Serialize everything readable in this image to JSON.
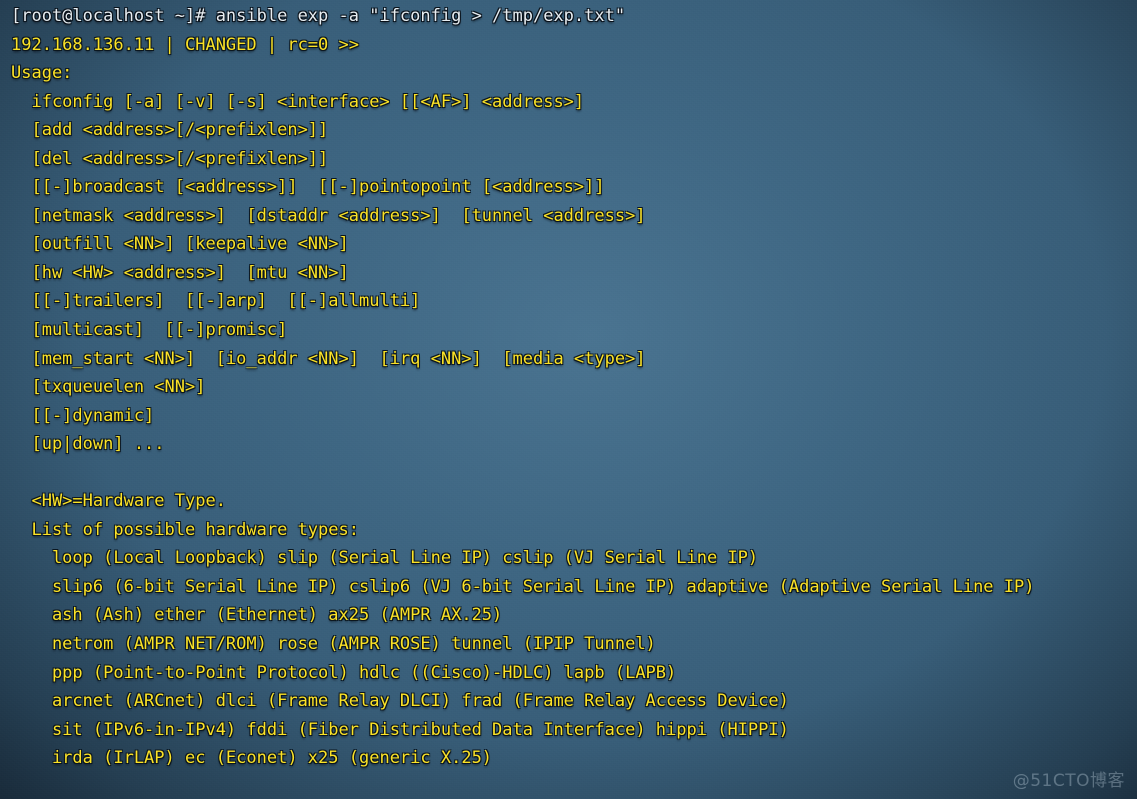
{
  "terminal": {
    "prompt_line": "[root@localhost ~]# ansible exp -a \"ifconfig > /tmp/exp.txt\"",
    "status_line": "192.168.136.11 | CHANGED | rc=0 >>",
    "lines": [
      {
        "text": "[root@localhost ~]# ansible exp -a \"ifconfig > /tmp/exp.txt\"",
        "style": "cmd"
      },
      {
        "text": "192.168.136.11 | CHANGED | rc=0 >>",
        "style": "out"
      },
      {
        "text": "Usage:",
        "style": "out"
      },
      {
        "text": "  ifconfig [-a] [-v] [-s] <interface> [[<AF>] <address>]",
        "style": "out"
      },
      {
        "text": "  [add <address>[/<prefixlen>]]",
        "style": "out"
      },
      {
        "text": "  [del <address>[/<prefixlen>]]",
        "style": "out"
      },
      {
        "text": "  [[-]broadcast [<address>]]  [[-]pointopoint [<address>]]",
        "style": "out"
      },
      {
        "text": "  [netmask <address>]  [dstaddr <address>]  [tunnel <address>]",
        "style": "out"
      },
      {
        "text": "  [outfill <NN>] [keepalive <NN>]",
        "style": "out"
      },
      {
        "text": "  [hw <HW> <address>]  [mtu <NN>]",
        "style": "out"
      },
      {
        "text": "  [[-]trailers]  [[-]arp]  [[-]allmulti]",
        "style": "out"
      },
      {
        "text": "  [multicast]  [[-]promisc]",
        "style": "out"
      },
      {
        "text": "  [mem_start <NN>]  [io_addr <NN>]  [irq <NN>]  [media <type>]",
        "style": "out"
      },
      {
        "text": "  [txqueuelen <NN>]",
        "style": "out"
      },
      {
        "text": "  [[-]dynamic]",
        "style": "out"
      },
      {
        "text": "  [up|down] ...",
        "style": "out"
      },
      {
        "text": "",
        "style": "out"
      },
      {
        "text": "  <HW>=Hardware Type.",
        "style": "out"
      },
      {
        "text": "  List of possible hardware types:",
        "style": "out"
      },
      {
        "text": "    loop (Local Loopback) slip (Serial Line IP) cslip (VJ Serial Line IP)",
        "style": "out"
      },
      {
        "text": "    slip6 (6-bit Serial Line IP) cslip6 (VJ 6-bit Serial Line IP) adaptive (Adaptive Serial Line IP)",
        "style": "out"
      },
      {
        "text": "    ash (Ash) ether (Ethernet) ax25 (AMPR AX.25)",
        "style": "out"
      },
      {
        "text": "    netrom (AMPR NET/ROM) rose (AMPR ROSE) tunnel (IPIP Tunnel)",
        "style": "out"
      },
      {
        "text": "    ppp (Point-to-Point Protocol) hdlc ((Cisco)-HDLC) lapb (LAPB)",
        "style": "out"
      },
      {
        "text": "    arcnet (ARCnet) dlci (Frame Relay DLCI) frad (Frame Relay Access Device)",
        "style": "out"
      },
      {
        "text": "    sit (IPv6-in-IPv4) fddi (Fiber Distributed Data Interface) hippi (HIPPI)",
        "style": "out"
      },
      {
        "text": "    irda (IrLAP) ec (Econet) x25 (generic X.25)",
        "style": "out"
      }
    ]
  },
  "watermark": {
    "text": "@51CTO博客"
  },
  "colors": {
    "background": "#3b637f",
    "command_text": "#e9eff3",
    "output_text": "#fde426",
    "watermark_text": "#cddeeb"
  }
}
